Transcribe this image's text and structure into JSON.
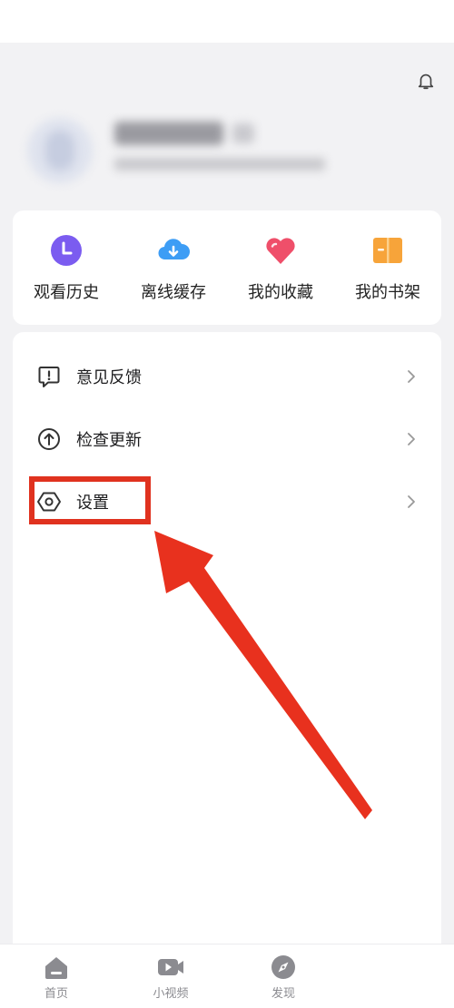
{
  "quick_actions": [
    {
      "label": "观看历史",
      "icon": "clock-icon",
      "color": "#7b5cf0"
    },
    {
      "label": "离线缓存",
      "icon": "cloud-download-icon",
      "color": "#3d9df5"
    },
    {
      "label": "我的收藏",
      "icon": "heart-icon",
      "color": "#ef4f6a"
    },
    {
      "label": "我的书架",
      "icon": "book-icon",
      "color": "#f7a43a"
    }
  ],
  "menu": [
    {
      "label": "意见反馈",
      "icon": "feedback-icon"
    },
    {
      "label": "检查更新",
      "icon": "update-arrow-icon"
    },
    {
      "label": "设置",
      "icon": "settings-hexagon-icon"
    }
  ],
  "tabs": [
    {
      "label": "首页",
      "icon": "home-icon"
    },
    {
      "label": "小视频",
      "icon": "video-icon"
    },
    {
      "label": "发现",
      "icon": "compass-icon"
    }
  ],
  "annotation_color": "#e0321f"
}
